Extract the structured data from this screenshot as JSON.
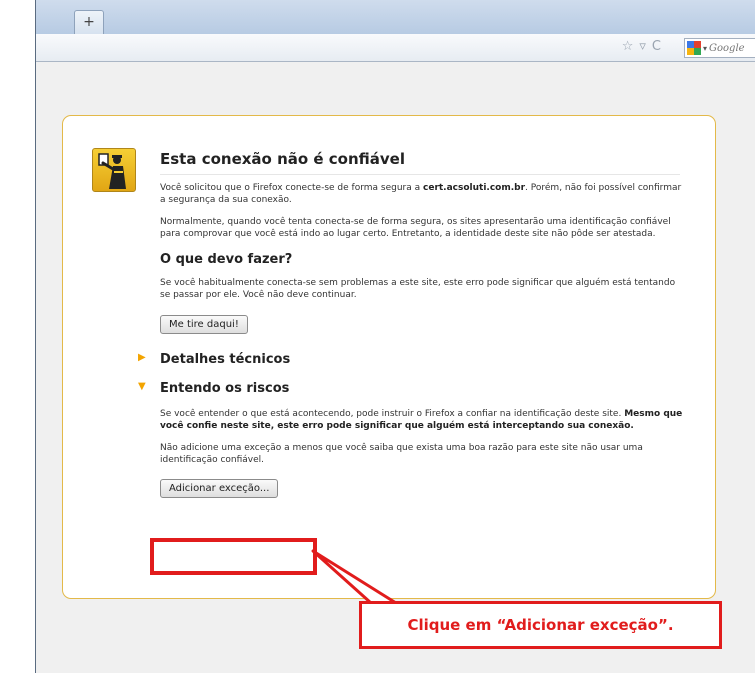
{
  "browser": {
    "new_tab_label": "+",
    "star_icon": "☆",
    "dropdown_icon": "▿",
    "reload_icon": "C",
    "search_dropdown": "▾",
    "search_placeholder": "Google"
  },
  "page": {
    "title": "Esta conexão não é confiável",
    "para1_pre": "Você solicitou que o Firefox conecte-se de forma segura a ",
    "para1_host": "cert.acsoluti.com.br",
    "para1_post": ". Porém, não foi possível confirmar a segurança da sua conexão.",
    "para2": "Normalmente, quando você tenta conecta-se de forma segura, os sites apresentarão uma identificação confiável para comprovar que você está indo ao lugar certo. Entretanto, a identidade deste site não pôde ser atestada.",
    "what_to_do_heading": "O que devo fazer?",
    "what_to_do_text": "Se você habitualmente conecta-se sem problemas a este site, este erro pode significar que alguém está tentando se passar por ele. Você não deve continuar.",
    "get_me_out_button": "Me tire daqui!",
    "technical_details": "Detalhes técnicos",
    "understand_risks": "Entendo os riscos",
    "risks_text": "Se você entender o que está acontecendo, pode instruir o Firefox a confiar na identificação deste site.",
    "risks_bold": "Mesmo que você confie neste site, este erro pode significar que alguém está interceptando sua conexão.",
    "exception_note": "Não adicione uma exceção a menos que você saiba que exista uma boa razão para este site não usar uma identificação confiável.",
    "add_exception_button": "Adicionar exceção..."
  },
  "annotation": {
    "callout_text": "Clique em “Adicionar exceção”.",
    "color": "#e11c1c"
  },
  "colors": {
    "card_border": "#e3b949",
    "expander_arrow": "#f3a400",
    "icon_yellow": "#f6cf35"
  }
}
